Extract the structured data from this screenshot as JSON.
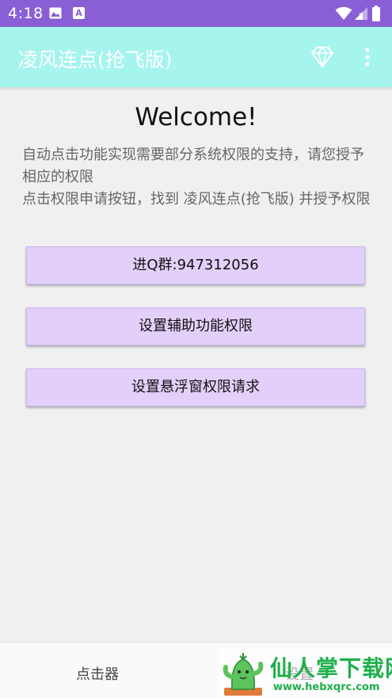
{
  "status_bar": {
    "time": "4:18",
    "icons": [
      "image-icon",
      "a-icon",
      "wifi-icon",
      "signal-icon",
      "battery-icon"
    ],
    "a_icon_text": "A",
    "color": "#8a5fd6"
  },
  "app_bar": {
    "title": "凌风连点(抢飞版)",
    "color": "#a6f4ee",
    "actions": [
      "diamond-icon",
      "more-vertical-icon"
    ]
  },
  "content": {
    "welcome": "Welcome!",
    "intro_line1": "自动点击功能实现需要部分系统权限的支持，请您授予相应的权限",
    "intro_line2": "点击权限申请按钮，找到 凌风连点(抢飞版) 并授予权限",
    "buttons": {
      "qq_group": "进Q群:947312056",
      "accessibility": "设置辅助功能权限",
      "floating_window": "设置悬浮窗权限请求"
    },
    "button_color": "#e3d0fa"
  },
  "bottom_nav": {
    "items": [
      {
        "label": "点击器"
      },
      {
        "label": "设置"
      }
    ]
  },
  "watermark": {
    "title": "仙人掌下载网",
    "url": "www.hebxqrc.com",
    "color": "#1fb04b"
  }
}
